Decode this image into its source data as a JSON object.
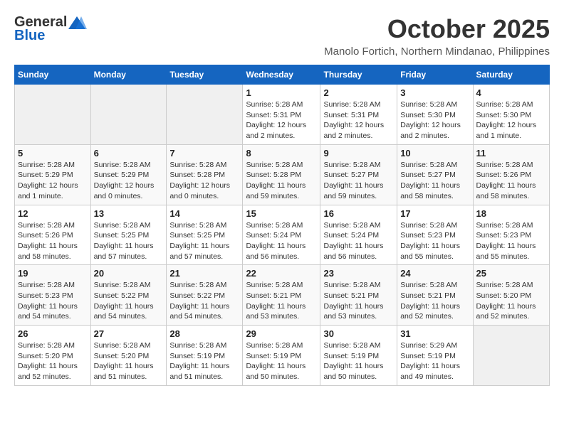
{
  "header": {
    "logo_general": "General",
    "logo_blue": "Blue",
    "month": "October 2025",
    "location": "Manolo Fortich, Northern Mindanao, Philippines"
  },
  "days_of_week": [
    "Sunday",
    "Monday",
    "Tuesday",
    "Wednesday",
    "Thursday",
    "Friday",
    "Saturday"
  ],
  "weeks": [
    [
      {
        "day": "",
        "sunrise": "",
        "sunset": "",
        "daylight": ""
      },
      {
        "day": "",
        "sunrise": "",
        "sunset": "",
        "daylight": ""
      },
      {
        "day": "",
        "sunrise": "",
        "sunset": "",
        "daylight": ""
      },
      {
        "day": "1",
        "sunrise": "Sunrise: 5:28 AM",
        "sunset": "Sunset: 5:31 PM",
        "daylight": "Daylight: 12 hours and 2 minutes."
      },
      {
        "day": "2",
        "sunrise": "Sunrise: 5:28 AM",
        "sunset": "Sunset: 5:31 PM",
        "daylight": "Daylight: 12 hours and 2 minutes."
      },
      {
        "day": "3",
        "sunrise": "Sunrise: 5:28 AM",
        "sunset": "Sunset: 5:30 PM",
        "daylight": "Daylight: 12 hours and 2 minutes."
      },
      {
        "day": "4",
        "sunrise": "Sunrise: 5:28 AM",
        "sunset": "Sunset: 5:30 PM",
        "daylight": "Daylight: 12 hours and 1 minute."
      }
    ],
    [
      {
        "day": "5",
        "sunrise": "Sunrise: 5:28 AM",
        "sunset": "Sunset: 5:29 PM",
        "daylight": "Daylight: 12 hours and 1 minute."
      },
      {
        "day": "6",
        "sunrise": "Sunrise: 5:28 AM",
        "sunset": "Sunset: 5:29 PM",
        "daylight": "Daylight: 12 hours and 0 minutes."
      },
      {
        "day": "7",
        "sunrise": "Sunrise: 5:28 AM",
        "sunset": "Sunset: 5:28 PM",
        "daylight": "Daylight: 12 hours and 0 minutes."
      },
      {
        "day": "8",
        "sunrise": "Sunrise: 5:28 AM",
        "sunset": "Sunset: 5:28 PM",
        "daylight": "Daylight: 11 hours and 59 minutes."
      },
      {
        "day": "9",
        "sunrise": "Sunrise: 5:28 AM",
        "sunset": "Sunset: 5:27 PM",
        "daylight": "Daylight: 11 hours and 59 minutes."
      },
      {
        "day": "10",
        "sunrise": "Sunrise: 5:28 AM",
        "sunset": "Sunset: 5:27 PM",
        "daylight": "Daylight: 11 hours and 58 minutes."
      },
      {
        "day": "11",
        "sunrise": "Sunrise: 5:28 AM",
        "sunset": "Sunset: 5:26 PM",
        "daylight": "Daylight: 11 hours and 58 minutes."
      }
    ],
    [
      {
        "day": "12",
        "sunrise": "Sunrise: 5:28 AM",
        "sunset": "Sunset: 5:26 PM",
        "daylight": "Daylight: 11 hours and 58 minutes."
      },
      {
        "day": "13",
        "sunrise": "Sunrise: 5:28 AM",
        "sunset": "Sunset: 5:25 PM",
        "daylight": "Daylight: 11 hours and 57 minutes."
      },
      {
        "day": "14",
        "sunrise": "Sunrise: 5:28 AM",
        "sunset": "Sunset: 5:25 PM",
        "daylight": "Daylight: 11 hours and 57 minutes."
      },
      {
        "day": "15",
        "sunrise": "Sunrise: 5:28 AM",
        "sunset": "Sunset: 5:24 PM",
        "daylight": "Daylight: 11 hours and 56 minutes."
      },
      {
        "day": "16",
        "sunrise": "Sunrise: 5:28 AM",
        "sunset": "Sunset: 5:24 PM",
        "daylight": "Daylight: 11 hours and 56 minutes."
      },
      {
        "day": "17",
        "sunrise": "Sunrise: 5:28 AM",
        "sunset": "Sunset: 5:23 PM",
        "daylight": "Daylight: 11 hours and 55 minutes."
      },
      {
        "day": "18",
        "sunrise": "Sunrise: 5:28 AM",
        "sunset": "Sunset: 5:23 PM",
        "daylight": "Daylight: 11 hours and 55 minutes."
      }
    ],
    [
      {
        "day": "19",
        "sunrise": "Sunrise: 5:28 AM",
        "sunset": "Sunset: 5:23 PM",
        "daylight": "Daylight: 11 hours and 54 minutes."
      },
      {
        "day": "20",
        "sunrise": "Sunrise: 5:28 AM",
        "sunset": "Sunset: 5:22 PM",
        "daylight": "Daylight: 11 hours and 54 minutes."
      },
      {
        "day": "21",
        "sunrise": "Sunrise: 5:28 AM",
        "sunset": "Sunset: 5:22 PM",
        "daylight": "Daylight: 11 hours and 54 minutes."
      },
      {
        "day": "22",
        "sunrise": "Sunrise: 5:28 AM",
        "sunset": "Sunset: 5:21 PM",
        "daylight": "Daylight: 11 hours and 53 minutes."
      },
      {
        "day": "23",
        "sunrise": "Sunrise: 5:28 AM",
        "sunset": "Sunset: 5:21 PM",
        "daylight": "Daylight: 11 hours and 53 minutes."
      },
      {
        "day": "24",
        "sunrise": "Sunrise: 5:28 AM",
        "sunset": "Sunset: 5:21 PM",
        "daylight": "Daylight: 11 hours and 52 minutes."
      },
      {
        "day": "25",
        "sunrise": "Sunrise: 5:28 AM",
        "sunset": "Sunset: 5:20 PM",
        "daylight": "Daylight: 11 hours and 52 minutes."
      }
    ],
    [
      {
        "day": "26",
        "sunrise": "Sunrise: 5:28 AM",
        "sunset": "Sunset: 5:20 PM",
        "daylight": "Daylight: 11 hours and 52 minutes."
      },
      {
        "day": "27",
        "sunrise": "Sunrise: 5:28 AM",
        "sunset": "Sunset: 5:20 PM",
        "daylight": "Daylight: 11 hours and 51 minutes."
      },
      {
        "day": "28",
        "sunrise": "Sunrise: 5:28 AM",
        "sunset": "Sunset: 5:19 PM",
        "daylight": "Daylight: 11 hours and 51 minutes."
      },
      {
        "day": "29",
        "sunrise": "Sunrise: 5:28 AM",
        "sunset": "Sunset: 5:19 PM",
        "daylight": "Daylight: 11 hours and 50 minutes."
      },
      {
        "day": "30",
        "sunrise": "Sunrise: 5:28 AM",
        "sunset": "Sunset: 5:19 PM",
        "daylight": "Daylight: 11 hours and 50 minutes."
      },
      {
        "day": "31",
        "sunrise": "Sunrise: 5:29 AM",
        "sunset": "Sunset: 5:19 PM",
        "daylight": "Daylight: 11 hours and 49 minutes."
      },
      {
        "day": "",
        "sunrise": "",
        "sunset": "",
        "daylight": ""
      }
    ]
  ]
}
